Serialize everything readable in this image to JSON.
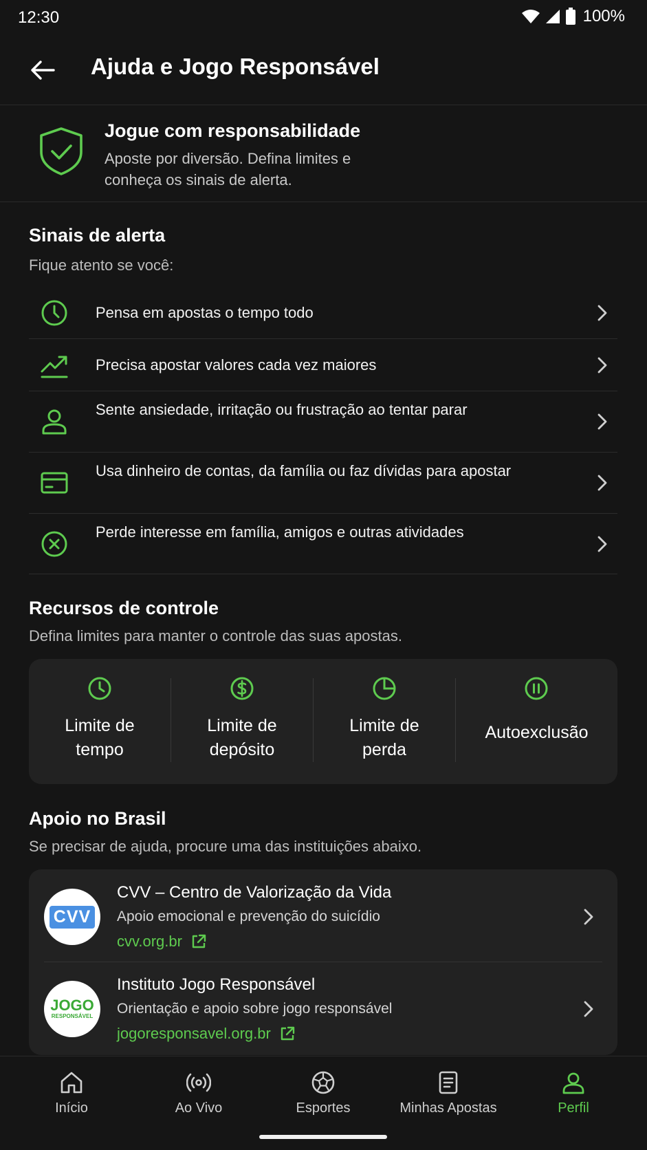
{
  "status_bar": {
    "time": "12:30",
    "battery": "100%"
  },
  "app_bar": {
    "title": "Ajuda e Jogo Responsável"
  },
  "banner": {
    "title": "Jogue com responsabilidade",
    "text": "Aposte por diversão. Defina limites e conheça os sinais de alerta."
  },
  "alerts": {
    "title": "Sinais de alerta",
    "subtitle": "Fique atento se você:",
    "items": [
      {
        "icon": "clock-icon",
        "text": "Pensa em apostas o tempo todo"
      },
      {
        "icon": "trending-up-icon",
        "text": "Precisa apostar valores cada vez maiores"
      },
      {
        "icon": "user-icon",
        "text": "Sente ansiedade, irritação ou frustração ao tentar parar"
      },
      {
        "icon": "credit-card-icon",
        "text": "Usa dinheiro de contas, da família ou faz dívidas para apostar"
      },
      {
        "icon": "x-circle-icon",
        "text": "Perde interesse em família, amigos e outras atividades"
      }
    ]
  },
  "controls": {
    "title": "Recursos de controle",
    "subtitle": "Defina limites para manter o controle das suas apostas.",
    "items": [
      {
        "icon": "clock-icon",
        "line1": "Limite de",
        "line2": "tempo"
      },
      {
        "icon": "dollar-icon",
        "line1": "Limite de",
        "line2": "depósito"
      },
      {
        "icon": "pie-chart-icon",
        "line1": "Limite de",
        "line2": "perda"
      },
      {
        "icon": "pause-icon",
        "line1": "Autoexclusão",
        "line2": ""
      }
    ]
  },
  "support": {
    "title": "Apoio no Brasil",
    "subtitle": "Se precisar de ajuda, procure uma das instituições abaixo.",
    "items": [
      {
        "logo_text": "CVV",
        "name": "CVV – Centro de Valorização da Vida",
        "description": "Apoio emocional e prevenção do suicídio",
        "link": "cvv.org.br"
      },
      {
        "logo_text": "JOGO",
        "logo_subtext": "RESPONSÁVEL",
        "name": "Instituto Jogo Responsável",
        "description": "Orientação e apoio sobre jogo responsável",
        "link": "jogoresponsavel.org.br"
      }
    ]
  },
  "bottom_nav": {
    "items": [
      {
        "icon": "home-icon",
        "label": "Início",
        "active": false
      },
      {
        "icon": "live-icon",
        "label": "Ao Vivo",
        "active": false
      },
      {
        "icon": "soccer-ball-icon",
        "label": "Esportes",
        "active": false
      },
      {
        "icon": "bets-icon",
        "label": "Minhas Apostas",
        "active": false
      },
      {
        "icon": "profile-icon",
        "label": "Perfil",
        "active": true
      }
    ]
  },
  "colors": {
    "accent": "#5ecb4f",
    "background": "#151515",
    "card": "#222222"
  }
}
